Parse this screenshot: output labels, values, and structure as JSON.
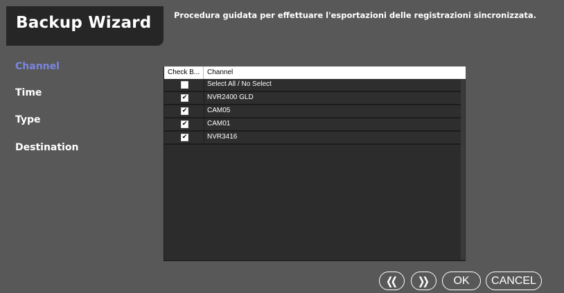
{
  "header": {
    "title": "Backup Wizard",
    "description": "Procedura guidata per effettuare l'esportazioni delle registrazioni sincronizzata."
  },
  "sidebar": {
    "items": [
      {
        "label": "Channel",
        "active": true
      },
      {
        "label": "Time",
        "active": false
      },
      {
        "label": "Type",
        "active": false
      },
      {
        "label": "Destination",
        "active": false
      }
    ]
  },
  "grid": {
    "columns": [
      "Check B...",
      "Channel"
    ],
    "rows": [
      {
        "checked": false,
        "label": "Select All / No Select"
      },
      {
        "checked": true,
        "label": "NVR2400 GLD"
      },
      {
        "checked": true,
        "label": "CAM05"
      },
      {
        "checked": true,
        "label": "CAM01"
      },
      {
        "checked": true,
        "label": "NVR3416"
      }
    ]
  },
  "footer": {
    "prev_icon": "double-chevron-left-icon",
    "next_icon": "double-chevron-right-icon",
    "ok_label": "OK",
    "cancel_label": "CANCEL"
  },
  "colors": {
    "background": "#585858",
    "title_box": "#262626",
    "grid_bg": "#2c2c2c",
    "active_nav": "#7b86e0"
  }
}
